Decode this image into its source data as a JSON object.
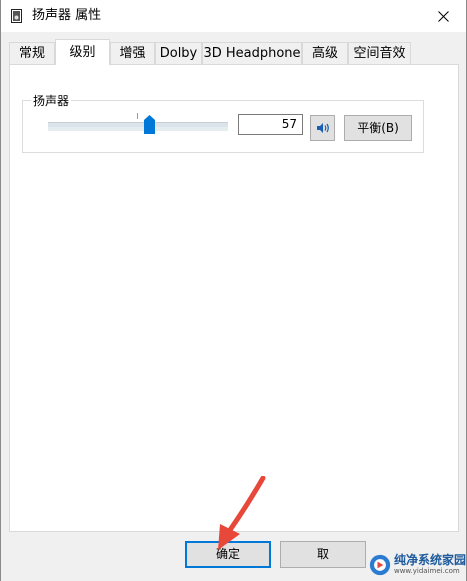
{
  "window": {
    "title": "扬声器 属性"
  },
  "tabs": [
    {
      "label": "常规",
      "active": false
    },
    {
      "label": "级别",
      "active": true
    },
    {
      "label": "增强",
      "active": false
    },
    {
      "label": "Dolby",
      "active": false
    },
    {
      "label": "3D Headphone",
      "active": false
    },
    {
      "label": "高级",
      "active": false
    },
    {
      "label": "空间音效",
      "active": false
    }
  ],
  "levels": {
    "group_label": "扬声器",
    "volume": 57,
    "volume_text": "57",
    "balance_label": "平衡(B)"
  },
  "footer": {
    "ok_label": "确定",
    "cancel_label": "取"
  },
  "watermark": {
    "title": "纯净系统家园",
    "url": "www.yidaimei.com"
  },
  "icons": {
    "app": "speaker-properties-icon",
    "close": "close-icon",
    "mute": "speaker-icon",
    "annotation": "red-arrow-annotation"
  },
  "colors": {
    "accent": "#0078d7",
    "slider_thumb": "#0078d7",
    "arrow": "#e8483a"
  }
}
